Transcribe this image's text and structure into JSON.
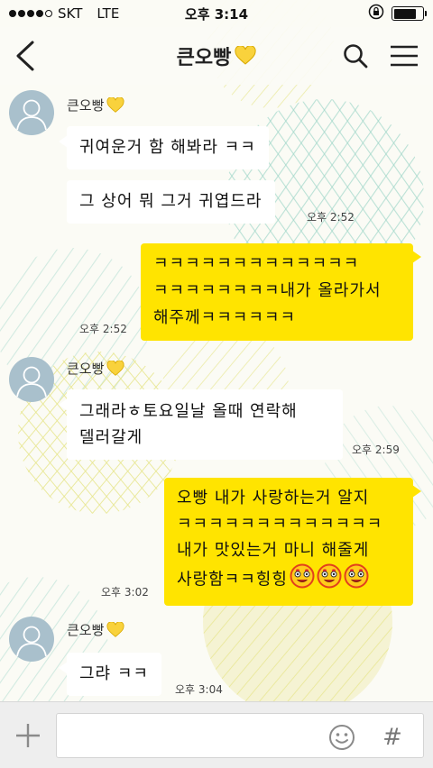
{
  "status_bar": {
    "carrier": "SKT",
    "network": "LTE",
    "time": "오후 3:14",
    "battery_level": 0.8
  },
  "header": {
    "title": "큰오빵",
    "title_icon": "yellow-heart-icon",
    "icons": [
      "back-arrow-icon",
      "search-icon",
      "menu-icon"
    ]
  },
  "messages": [
    {
      "side": "received",
      "sender": "큰오빵",
      "text": "귀여운거 함 해봐라 ㅋㅋ",
      "time": ""
    },
    {
      "side": "received",
      "text": "그 상어 뭐 그거 귀엽드라",
      "time": "오후 2:52"
    },
    {
      "side": "sent",
      "lines": [
        "ㅋㅋㅋㅋㅋㅋㅋㅋㅋㅋㅋㅋㅋ",
        "ㅋㅋㅋㅋㅋㅋㅋㅋ내가 올라가서",
        "해주께ㅋㅋㅋㅋㅋㅋ"
      ],
      "time": "오후 2:52"
    },
    {
      "side": "received",
      "sender": "큰오빵",
      "lines": [
        "그래라ㅎ토요일날 올때 연락해",
        "델러갈게"
      ],
      "time": "오후 2:59"
    },
    {
      "side": "sent",
      "lines": [
        "오빵 내가 사랑하는거 알지",
        "ㅋㅋㅋㅋㅋㅋㅋㅋㅋㅋㅋㅋㅋ",
        "내가 맛있는거 마니 해줄게",
        "사랑함ㅋㅋ힝힝"
      ],
      "emojis": [
        "heart-eyes-emoji",
        "heart-eyes-emoji",
        "heart-eyes-emoji"
      ],
      "time": "오후 3:02"
    },
    {
      "side": "received",
      "sender": "큰오빵",
      "text": "그랴 ㅋㅋ",
      "time": "오후 3:04"
    }
  ],
  "input_bar": {
    "value": "",
    "placeholder": "",
    "icons": [
      "plus-icon",
      "emoticon-icon",
      "hash-icon"
    ],
    "hash_label": "#"
  },
  "colors": {
    "sent_bubble": "#ffe400",
    "received_bubble": "#ffffff",
    "avatar": "#a9c0cc",
    "background": "#fbfbf5"
  }
}
